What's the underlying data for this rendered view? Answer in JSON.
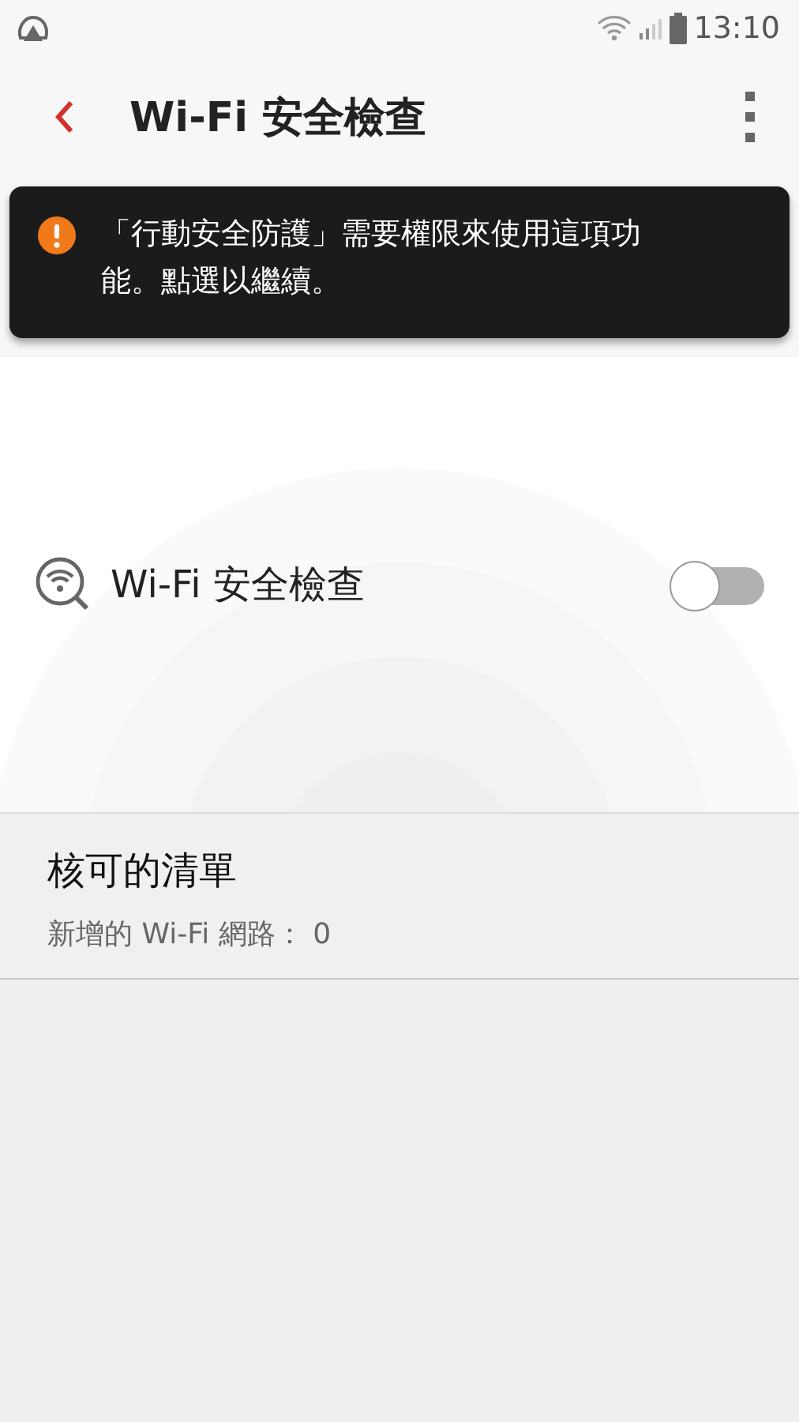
{
  "status_bar": {
    "time": "13:10"
  },
  "app_bar": {
    "title": "Wi-Fi 安全檢查"
  },
  "banner": {
    "text": "「行動安全防護」需要權限來使用這項功能。點選以繼續。"
  },
  "feature": {
    "label": "Wi-Fi 安全檢查",
    "on": false
  },
  "approved_list": {
    "title": "核可的清單",
    "subtitle": "新增的 Wi-Fi 網路： 0"
  }
}
